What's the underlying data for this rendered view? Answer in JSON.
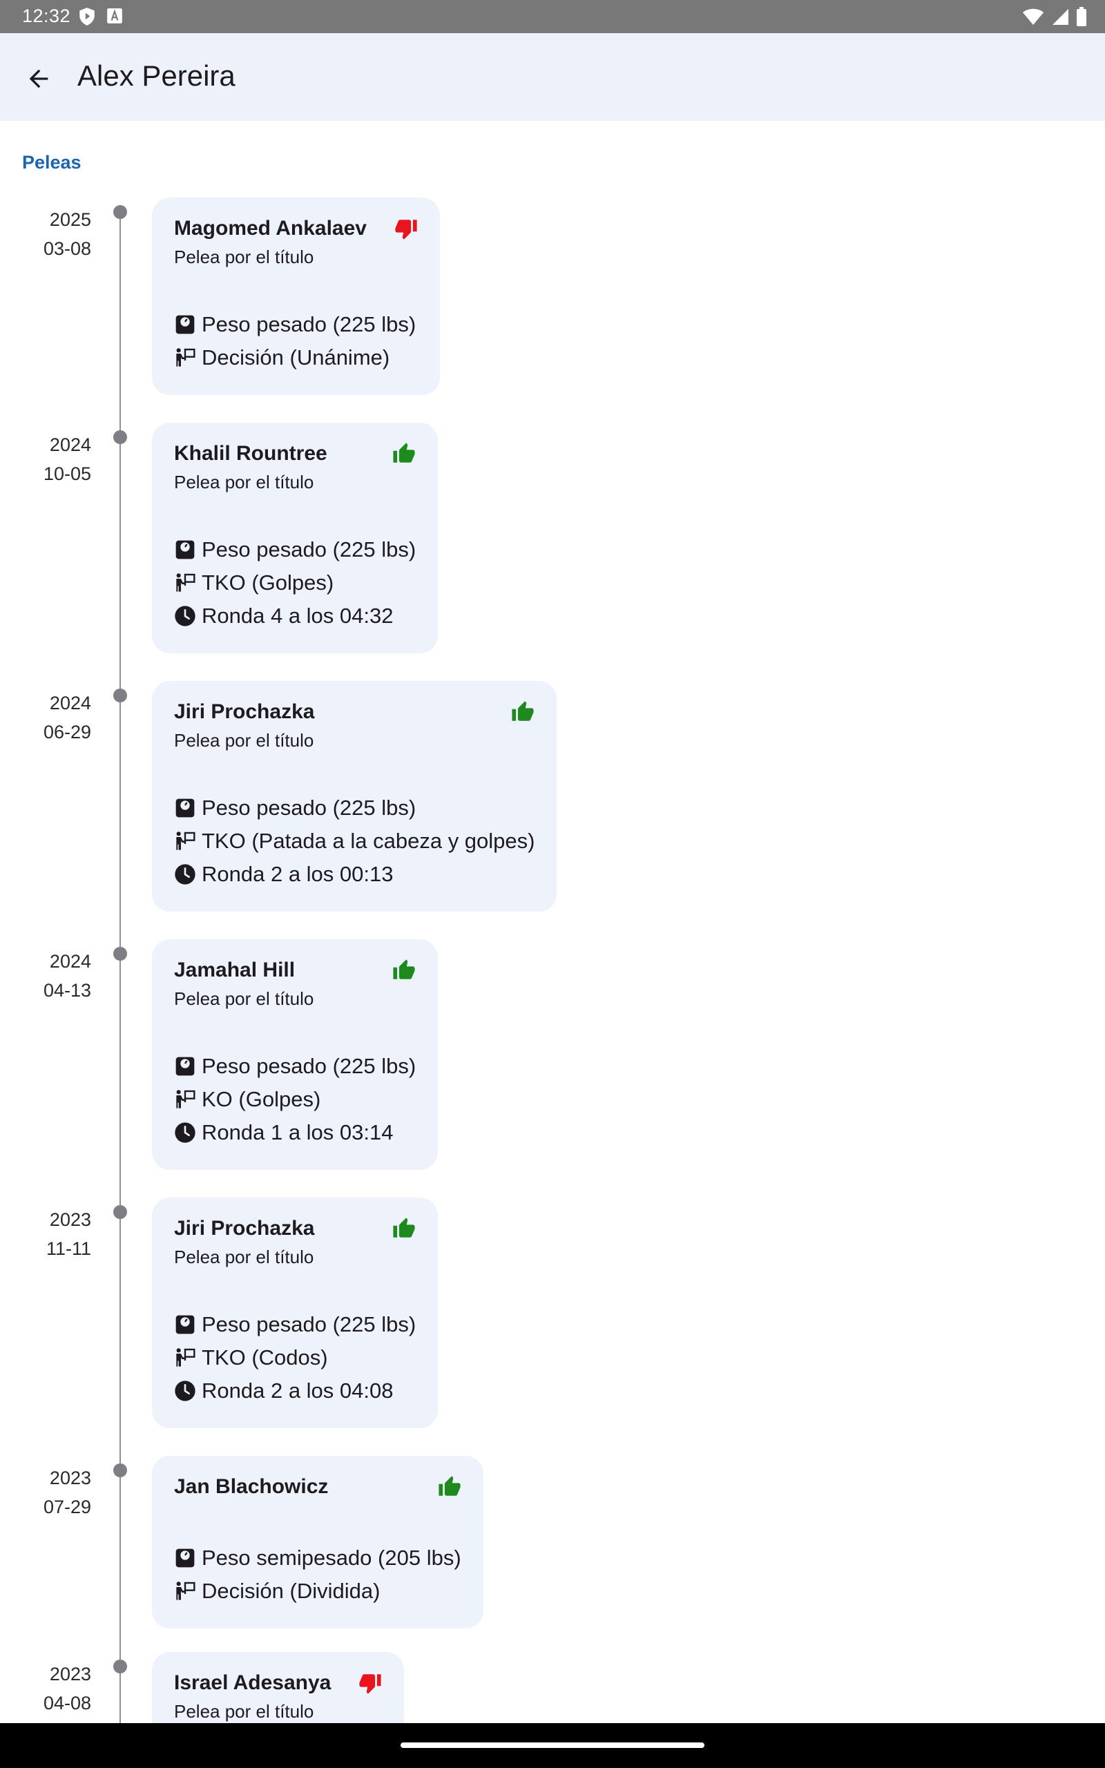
{
  "status_bar": {
    "time": "12:32"
  },
  "app_bar": {
    "title": "Alex Pereira"
  },
  "section": {
    "label": "Peleas"
  },
  "fights": [
    {
      "year": "2025",
      "date": "03-08",
      "opponent": "Magomed Ankalaev",
      "result": "loss",
      "title_fight": "Pelea por el título",
      "weight": "Peso pesado (225 lbs)",
      "method": "Decisión (Unánime)",
      "time": ""
    },
    {
      "year": "2024",
      "date": "10-05",
      "opponent": "Khalil Rountree",
      "result": "win",
      "title_fight": "Pelea por el título",
      "weight": "Peso pesado (225 lbs)",
      "method": "TKO (Golpes)",
      "time": "Ronda 4 a los 04:32"
    },
    {
      "year": "2024",
      "date": "06-29",
      "opponent": "Jiri Prochazka",
      "result": "win",
      "title_fight": "Pelea por el título",
      "weight": "Peso pesado (225 lbs)",
      "method": "TKO (Patada a la cabeza y golpes)",
      "time": "Ronda 2 a los 00:13"
    },
    {
      "year": "2024",
      "date": "04-13",
      "opponent": "Jamahal Hill",
      "result": "win",
      "title_fight": "Pelea por el título",
      "weight": "Peso pesado (225 lbs)",
      "method": "KO (Golpes)",
      "time": "Ronda 1 a los 03:14"
    },
    {
      "year": "2023",
      "date": "11-11",
      "opponent": "Jiri Prochazka",
      "result": "win",
      "title_fight": "Pelea por el título",
      "weight": "Peso pesado (225 lbs)",
      "method": "TKO (Codos)",
      "time": "Ronda 2 a los 04:08"
    },
    {
      "year": "2023",
      "date": "07-29",
      "opponent": "Jan Blachowicz",
      "result": "win",
      "title_fight": "",
      "weight": "Peso semipesado (205 lbs)",
      "method": "Decisión (Dividida)",
      "time": ""
    },
    {
      "year": "2023",
      "date": "04-08",
      "opponent": "Israel Adesanya",
      "result": "loss",
      "title_fight": "Pelea por el título",
      "weight": "",
      "method": "",
      "time": ""
    }
  ],
  "colors": {
    "win": "#1e8a1e",
    "loss": "#e8141e",
    "accent": "#1b65b0",
    "card": "#edf2fb"
  },
  "icons": {
    "back": "arrow-back-icon",
    "win": "thumb-up-icon",
    "loss": "thumb-down-icon",
    "weight": "scale-icon",
    "method": "referee-icon",
    "time": "clock-icon"
  }
}
